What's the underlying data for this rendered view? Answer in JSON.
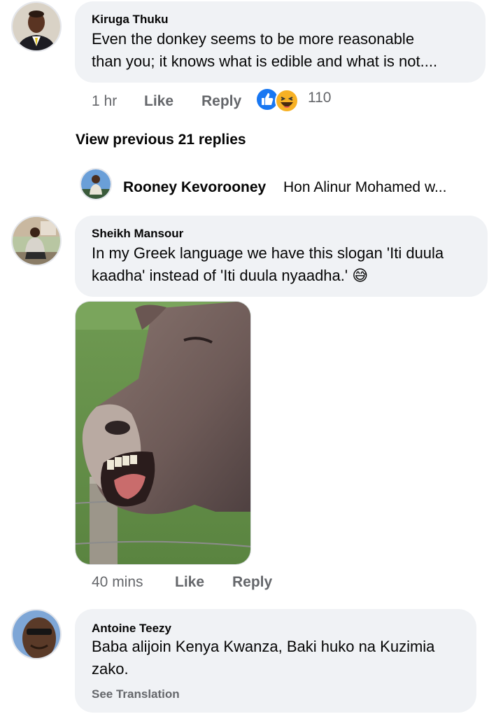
{
  "comments": [
    {
      "author": "Kiruga Thuku",
      "text_line1": "Even the donkey seems to be more reasonable",
      "text_line2": "than you; it knows what is edible and what is not....",
      "time": "1 hr",
      "like_label": "Like",
      "reply_label": "Reply",
      "reaction_count": "110",
      "reactions": [
        "like",
        "haha"
      ]
    },
    {
      "author": "Sheikh Mansour",
      "text_line1": "In my Greek language we have this slogan 'Iti duula",
      "text_line2": "kaadha' instead of 'Iti duula nyaadha.'",
      "emoji": "😅",
      "time": "40 mins",
      "like_label": "Like",
      "reply_label": "Reply"
    },
    {
      "author": "Antoine Teezy",
      "text_line1": "Baba alijoin Kenya Kwanza, Baki huko na Kuzimia",
      "text_line2": "zako.",
      "see_translation": "See Translation"
    }
  ],
  "view_previous": "View previous 21 replies",
  "reply_preview": {
    "author": "Rooney Kevorooney",
    "text": "Hon Alinur Mohamed w..."
  },
  "colors": {
    "bubble": "#f0f2f5",
    "meta": "#65676b",
    "like_blue": "#1877f2",
    "haha_yellow": "#f7b125"
  },
  "icons": {
    "like_reaction": "thumbs-up-icon",
    "haha_reaction": "laughing-face-icon",
    "attached_image": "laughing-donkey-photo"
  }
}
